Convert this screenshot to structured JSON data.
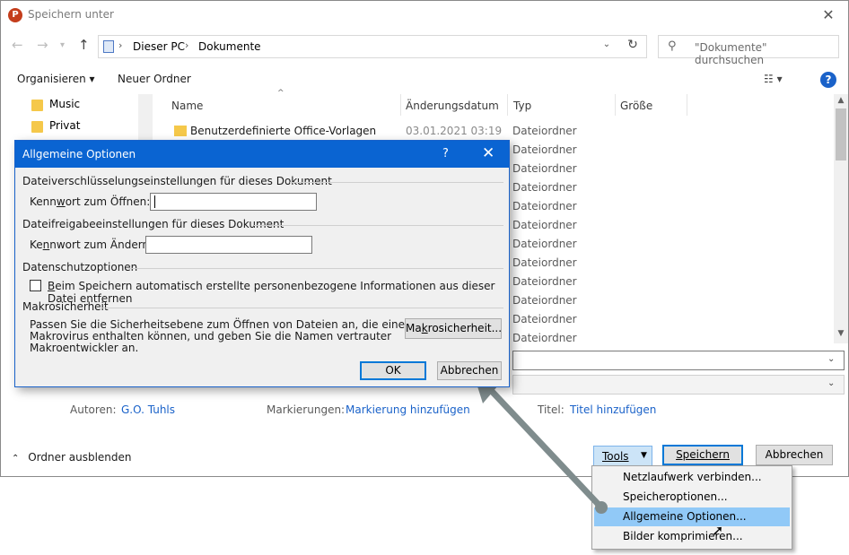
{
  "window": {
    "title": "Speichern unter",
    "app_icon": "P",
    "close": "✕"
  },
  "address": {
    "segments": [
      "Dieser PC",
      "Dokumente"
    ],
    "sep": "›"
  },
  "search": {
    "placeholder": "\"Dokumente\" durchsuchen"
  },
  "toolbar": {
    "organize": "Organisieren ▾",
    "new_folder": "Neuer Ordner"
  },
  "nav_pane": {
    "items": [
      "Music",
      "Privat"
    ]
  },
  "file_list": {
    "columns": [
      "Name",
      "Änderungsdatum",
      "Typ",
      "Größe"
    ],
    "rows": [
      {
        "name": "Benutzerdefinierte Office-Vorlagen",
        "date": "03.01.2021 03:19",
        "type": "Dateiordner"
      }
    ],
    "extra_types": [
      "Dateiordner",
      "Dateiordner",
      "Dateiordner",
      "Dateiordner",
      "Dateiordner",
      "Dateiordner",
      "Dateiordner",
      "Dateiordner",
      "Dateiordner",
      "Dateiordner",
      "Dateiordner"
    ]
  },
  "meta": {
    "authors_label": "Autoren:",
    "authors_value": "G.O. Tuhls",
    "tags_label": "Markierungen:",
    "tags_value": "Markierung hinzufügen",
    "title_label": "Titel:",
    "title_value": "Titel hinzufügen"
  },
  "footer": {
    "hide_folders": "Ordner ausblenden",
    "tools": "Tools",
    "save": "Speichern",
    "cancel": "Abbrechen"
  },
  "tools_menu": {
    "items": [
      "Netzlaufwerk verbinden...",
      "Speicheroptionen...",
      "Allgemeine Optionen...",
      "Bilder komprimieren..."
    ],
    "highlighted_index": 2
  },
  "dialog": {
    "title": "Allgemeine Optionen",
    "help": "?",
    "close": "✕",
    "encryption_section": "Dateiverschlüsselungseinstellungen für dieses Dokument",
    "open_pw_label_pre": "Kenn",
    "open_pw_label_ul": "w",
    "open_pw_label_post": "ort zum Öffnen:",
    "open_pw_value": "",
    "sharing_section": "Dateifreigabeeinstellungen für dieses Dokument",
    "modify_pw_label_pre": "Ke",
    "modify_pw_label_ul": "n",
    "modify_pw_label_post": "nwort zum Ändern:",
    "modify_pw_value": "",
    "privacy_section": "Datenschutzoptionen",
    "privacy_checkbox_ul": "B",
    "privacy_checkbox_rest": "eim Speichern automatisch erstellte personenbezogene Informationen aus dieser Datei entfernen",
    "privacy_checked": false,
    "macro_section": "Makrosicherheit",
    "macro_text_1": "Passen Sie die Sicherheitsebene zum Öffnen von Dateien an, die einen",
    "macro_text_2": "Makrovirus enthalten können, und geben Sie die Namen vertrauter",
    "macro_text_3": "Makroentwickler an.",
    "macro_button_pre": "Ma",
    "macro_button_ul": "k",
    "macro_button_post": "rosicherheit...",
    "ok": "OK",
    "cancel": "Abbrechen"
  },
  "colors": {
    "accent": "#0078d7",
    "dialog_title": "#0a64d2",
    "link": "#1a62c9",
    "menu_highlight": "#91c9f7",
    "annotation_arrow": "#7f8c8d"
  }
}
